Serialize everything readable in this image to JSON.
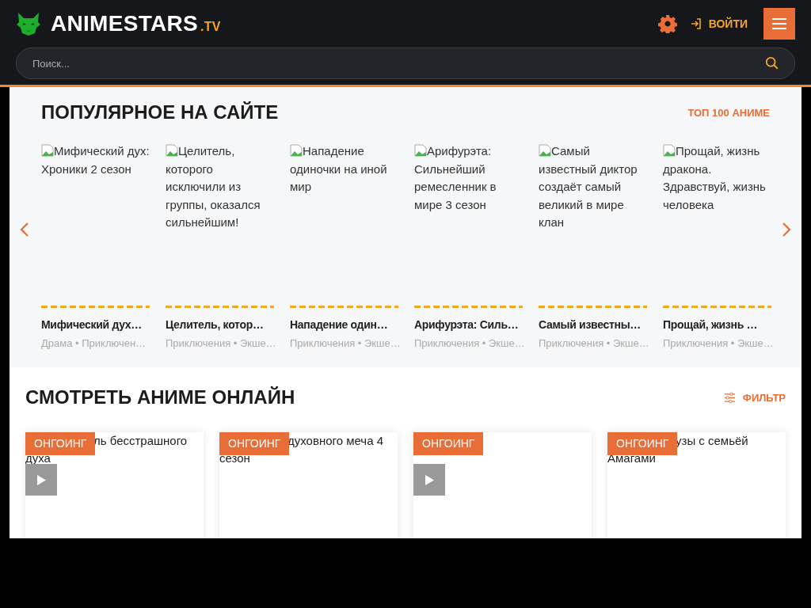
{
  "header": {
    "logo_name": "ANIMESTARS",
    "logo_suffix": ".TV",
    "login": "ВОЙТИ",
    "search": {
      "placeholder": "Поиск..."
    }
  },
  "popular": {
    "title": "ПОПУЛЯРНОЕ НА САЙТЕ",
    "link": "ТОП 100 АНИМЕ",
    "items": [
      {
        "alt": "Мифический дух: Хроники 2 сезон",
        "title": "Мифический дух…",
        "genres": "Драма • Приключен…"
      },
      {
        "alt": "Целитель, которого исключили из группы, оказался сильнейшим!",
        "title": "Целитель, котор…",
        "genres": "Приключения • Экше…"
      },
      {
        "alt": "Нападение одиночки на иной мир",
        "title": "Нападение один…",
        "genres": "Приключения • Экше…"
      },
      {
        "alt": "Арифурэта: Сильнейший ремесленник в мире 3 сезон",
        "title": "Арифурэта: Силь…",
        "genres": "Приключения • Экше…"
      },
      {
        "alt": "Самый известный диктор создаёт самый великий в мире клан",
        "title": "Самый известны…",
        "genres": "Приключения • Экше…"
      },
      {
        "alt": "Прощай, жизнь дракона. Здравствуй, жизнь человека",
        "title": "Прощай, жизнь …",
        "genres": "Приключения • Экше…"
      }
    ]
  },
  "online": {
    "title": "СМОТРЕТЬ АНИМЕ ОНЛАЙН",
    "filter": "ФИЛЬТР",
    "cards": [
      {
        "badge": "ОНГОИНГ",
        "alt_lines": [
          "ль бесстрашного",
          "духа"
        ],
        "play": true
      },
      {
        "badge": "ОНГОИНГ",
        "alt_lines": [
          "духовного меча 4",
          "сезон"
        ],
        "play": false
      },
      {
        "badge": "ОНГОИНГ",
        "play": true
      },
      {
        "badge": "ОНГОИНГ",
        "alt_lines": [
          "узы с семьёй",
          "Амагами"
        ],
        "play": false
      }
    ]
  }
}
